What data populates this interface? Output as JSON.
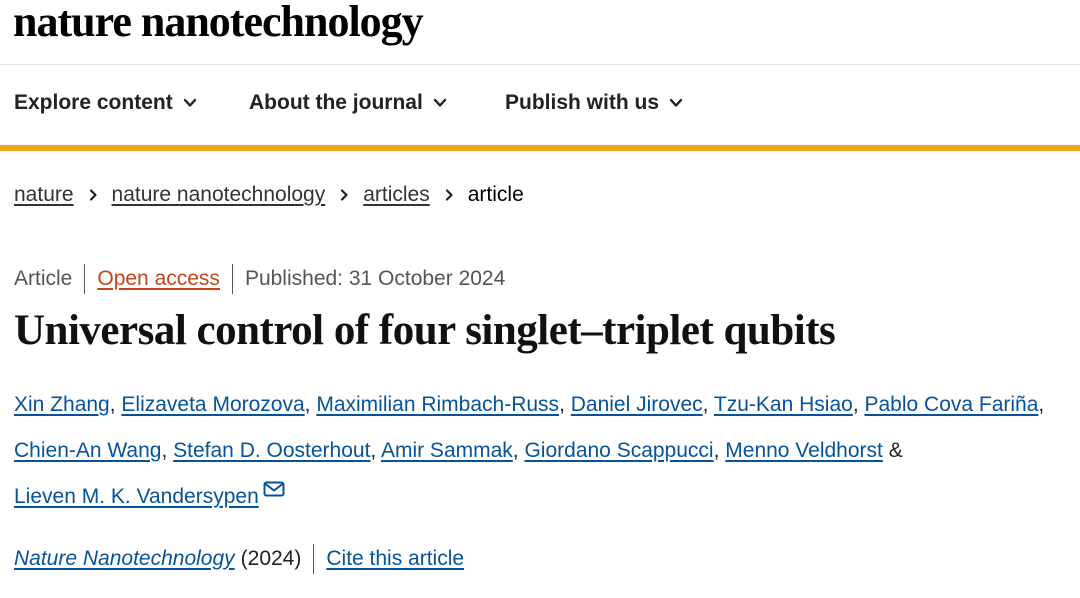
{
  "site": {
    "logo": "nature nanotechnology"
  },
  "nav": {
    "items": [
      {
        "label": "Explore content",
        "icon": "chevron-down-icon"
      },
      {
        "label": "About the journal",
        "icon": "chevron-down-icon"
      },
      {
        "label": "Publish with us",
        "icon": "chevron-down-icon"
      }
    ],
    "accent_color": "#f0a31c"
  },
  "breadcrumb": {
    "items": [
      "nature",
      "nature nanotechnology",
      "articles"
    ],
    "current": "article"
  },
  "article": {
    "type": "Article",
    "access": "Open access",
    "published": "Published: 31 October 2024",
    "title": "Universal control of four singlet–triplet qubits",
    "authors": [
      "Xin Zhang",
      "Elizaveta Morozova",
      "Maximilian Rimbach-Russ",
      "Daniel Jirovec",
      "Tzu-Kan Hsiao",
      "Pablo Cova Fariña",
      "Chien-An Wang",
      "Stefan D. Oosterhout",
      "Amir Sammak",
      "Giordano Scappucci",
      "Menno Veldhorst",
      "Lieven M. K. Vandersypen"
    ],
    "author_separator": ", ",
    "author_last_joiner": "&",
    "journal": "Nature Nanotechnology",
    "year": "(2024)",
    "cite_label": "Cite this article"
  },
  "colors": {
    "link": "#06529b",
    "open_access": "#c7431a"
  }
}
